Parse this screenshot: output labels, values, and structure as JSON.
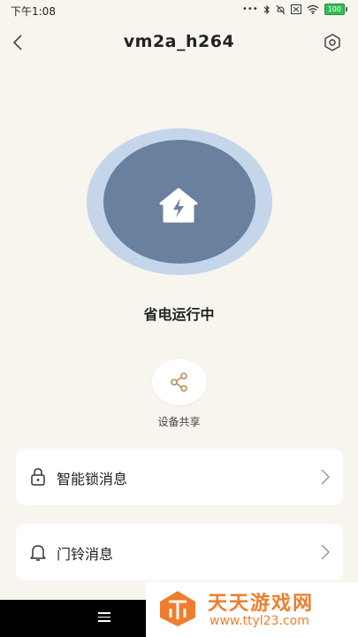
{
  "status_bar": {
    "time": "下午1:08",
    "battery": "100"
  },
  "header": {
    "title": "vm2a_h264"
  },
  "device": {
    "status": "省电运行中"
  },
  "share": {
    "label": "设备共享"
  },
  "menu": [
    {
      "label": "智能锁消息",
      "icon": "lock-icon"
    },
    {
      "label": "门铃消息",
      "icon": "bell-icon"
    }
  ],
  "watermark": {
    "title": "天天游戏网",
    "url": "www.ttyl23.com"
  },
  "colors": {
    "background": "#f8f5ef",
    "circle_outer": "#c5d6ea",
    "circle_inner": "#69819e",
    "accent": "#f07d2d"
  }
}
